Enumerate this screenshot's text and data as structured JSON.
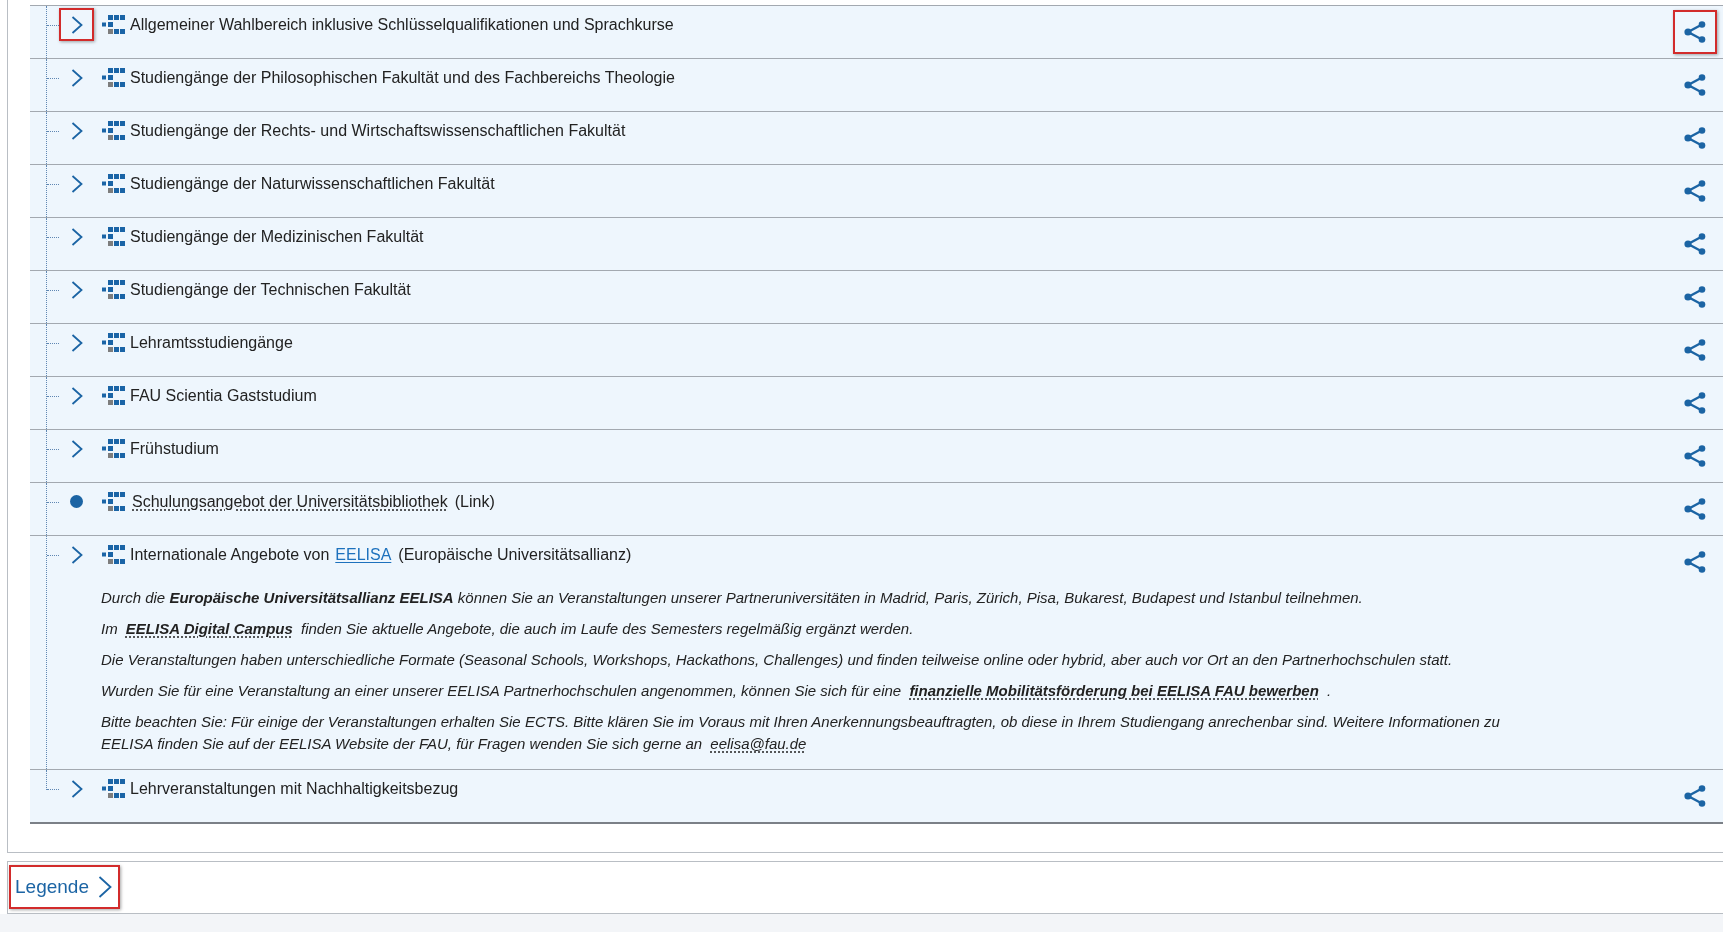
{
  "tree": {
    "items": [
      {
        "kind": "folder",
        "label": "Allgemeiner Wahlbereich inklusive Schlüsselqualifikationen und Sprachkurse",
        "toggle_highlighted": true,
        "share_highlighted": true
      },
      {
        "kind": "folder",
        "label": "Studiengänge der Philosophischen Fakultät und des Fachbereichs Theologie",
        "toggle_highlighted": false,
        "share_highlighted": false
      },
      {
        "kind": "folder",
        "label": "Studiengänge der Rechts- und Wirtschaftswissenschaftlichen Fakultät",
        "toggle_highlighted": false,
        "share_highlighted": false
      },
      {
        "kind": "folder",
        "label": "Studiengänge der Naturwissenschaftlichen Fakultät",
        "toggle_highlighted": false,
        "share_highlighted": false
      },
      {
        "kind": "folder",
        "label": "Studiengänge der Medizinischen Fakultät",
        "toggle_highlighted": false,
        "share_highlighted": false
      },
      {
        "kind": "folder",
        "label": "Studiengänge der Technischen Fakultät",
        "toggle_highlighted": false,
        "share_highlighted": false
      },
      {
        "kind": "folder",
        "label": "Lehramtsstudiengänge",
        "toggle_highlighted": false,
        "share_highlighted": false
      },
      {
        "kind": "folder",
        "label": "FAU Scientia Gaststudium",
        "toggle_highlighted": false,
        "share_highlighted": false
      },
      {
        "kind": "folder",
        "label": "Frühstudium",
        "toggle_highlighted": false,
        "share_highlighted": false
      },
      {
        "kind": "link",
        "link": "Schulungsangebot der Universitätsbibliothek",
        "suffix": "(Link)",
        "toggle_highlighted": false,
        "share_highlighted": false
      },
      {
        "kind": "folder",
        "label": "Internationale Angebote von",
        "link": "EELISA",
        "suffix": "(Europäische Universitätsallianz)",
        "toggle_highlighted": false,
        "share_highlighted": false,
        "description": [
          {
            "text": "Durch die **Europäische Universitätsallianz EELISA** können Sie an Veranstaltungen unserer Partneruniversitäten in Madrid, Paris, Zürich, Pisa, Bukarest, Budapest und Istanbul teilnehmen."
          },
          {
            "text": "Im",
            "link": "EELISA Digital Campus",
            "link_bold": true,
            "after": "finden Sie aktuelle Angebote, die auch im Laufe des Semesters regelmäßig ergänzt werden."
          },
          {
            "text": "Die Veranstaltungen haben unterschiedliche Formate (Seasonal Schools, Workshops, Hackathons, Challenges) und finden teilweise online oder hybrid, aber auch vor Ort an den Partnerhochschulen statt."
          },
          {
            "text": "Wurden Sie für eine Veranstaltung an einer unserer EELISA Partnerhochschulen angenommen, können Sie sich für eine",
            "link": "finanzielle Mobilitätsförderung bei EELISA FAU bewerben",
            "link_bold": true,
            "after": "."
          },
          {
            "text": "Bitte beachten Sie: Für einige der Veranstaltungen erhalten Sie ECTS. Bitte klären Sie im Voraus mit Ihren Anerkennungsbeauftragten, ob diese in Ihrem Studiengang anrechenbar sind. Weitere Informationen zu EELISA finden Sie auf der EELISA Website der FAU, für Fragen wenden Sie sich gerne an",
            "link": "eelisa@fau.de",
            "link_bold": false
          }
        ]
      },
      {
        "kind": "folder",
        "label": "Lehrveranstaltungen mit Nachhaltigkeitsbezug",
        "toggle_highlighted": false,
        "share_highlighted": false
      }
    ]
  },
  "legend": {
    "label": "Legende",
    "highlighted": true
  }
}
